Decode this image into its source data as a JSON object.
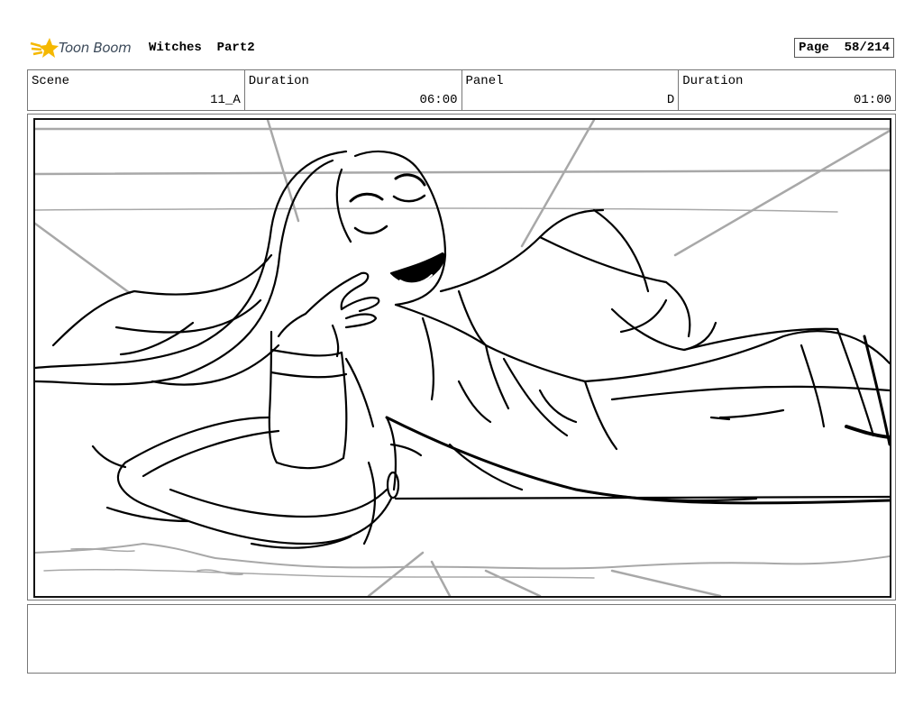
{
  "header": {
    "logo_text": "Toon Boom",
    "project": "Witches  Part2",
    "page": "Page  58/214"
  },
  "info": {
    "scene_label": "Scene",
    "scene_value": "11_A",
    "duration_label": "Duration",
    "duration_value": "06:00",
    "panel_label": "Panel",
    "panel_value": "D",
    "panel_duration_label": "Duration",
    "panel_duration_value": "01:00"
  },
  "colors": {
    "logo_star": "#f5b800",
    "logo_text": "#3c4a5a",
    "sketch_line": "#000000",
    "perspective_line": "#a8a8a8"
  },
  "notes": ""
}
